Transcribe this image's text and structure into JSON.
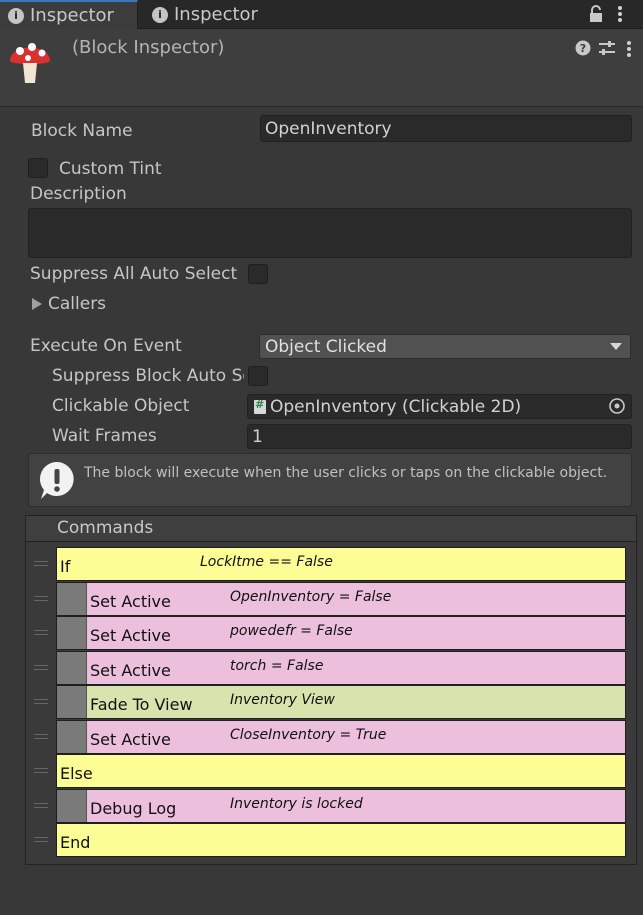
{
  "tabs": [
    {
      "label": "Inspector",
      "icon": "info-icon",
      "active": true
    },
    {
      "label": "Inspector",
      "icon": "info-icon",
      "active": false
    }
  ],
  "header": {
    "title": "(Block Inspector)"
  },
  "fields": {
    "block_name_label": "Block Name",
    "block_name_value": "OpenInventory",
    "custom_tint_label": "Custom Tint",
    "description_label": "Description",
    "description_value": "",
    "suppress_all_label": "Suppress All Auto Select",
    "callers_label": "Callers",
    "execute_label": "Execute On Event",
    "execute_value": "Object Clicked",
    "suppress_block_label": "Suppress Block Auto Select",
    "clickable_label": "Clickable Object",
    "clickable_value": "OpenInventory (Clickable 2D)",
    "wait_frames_label": "Wait Frames",
    "wait_frames_value": "1"
  },
  "help": {
    "text": "The block will execute when the user clicks or taps on the clickable object."
  },
  "commands": {
    "header": "Commands",
    "rows": [
      {
        "name": "If",
        "summary": "LockItme == False",
        "color": "#fdfd96",
        "indent": false
      },
      {
        "name": "Set Active",
        "summary": "OpenInventory = False",
        "color": "#ecc0dc",
        "indent": true
      },
      {
        "name": "Set Active",
        "summary": "powedefr = False",
        "color": "#ecc0dc",
        "indent": true
      },
      {
        "name": "Set Active",
        "summary": "torch = False",
        "color": "#ecc0dc",
        "indent": true
      },
      {
        "name": "Fade To View",
        "summary": "Inventory View",
        "color": "#d8e4ad",
        "indent": true
      },
      {
        "name": "Set Active",
        "summary": "CloseInventory = True",
        "color": "#ecc0dc",
        "indent": true
      },
      {
        "name": "Else",
        "summary": "",
        "color": "#fdfd96",
        "indent": false
      },
      {
        "name": "Debug Log",
        "summary": "Inventory is locked",
        "color": "#ecc0dc",
        "indent": true
      },
      {
        "name": "End",
        "summary": "",
        "color": "#fdfd96",
        "indent": false
      }
    ]
  }
}
